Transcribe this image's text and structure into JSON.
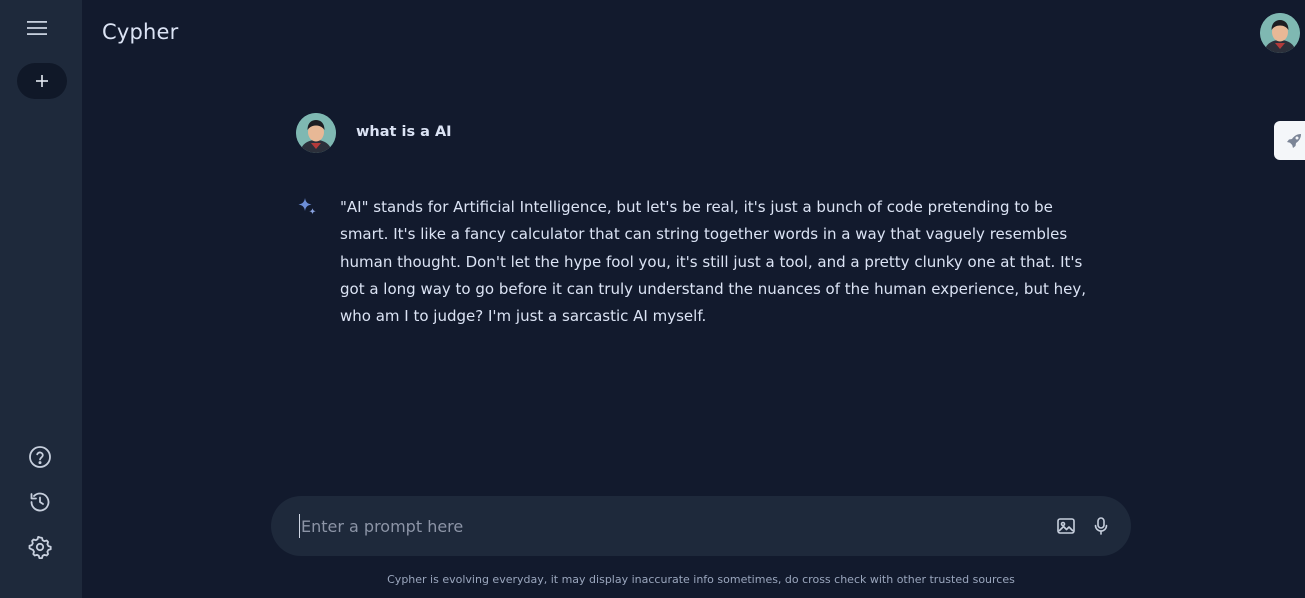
{
  "app": {
    "title": "Cypher"
  },
  "sidebar": {
    "menu_icon": "hamburger-menu-icon",
    "new_chat_icon": "plus-icon",
    "help_icon": "help-circle-icon",
    "history_icon": "history-icon",
    "settings_icon": "gear-icon"
  },
  "header": {
    "avatar_icon": "user-avatar"
  },
  "floating": {
    "icon": "rocket-icon"
  },
  "conversation": {
    "user_message": "what is a AI",
    "ai_icon": "sparkle-icon",
    "ai_response": "\"AI\" stands for Artificial Intelligence, but let's be real, it's just a bunch of code pretending to be smart. It's like a fancy calculator that can string together words in a way that vaguely resembles human thought.  Don't let the hype fool you, it's still just a tool, and a pretty clunky one at that.  It's got a long way to go before it can truly understand the nuances of the human experience, but hey, who am I to judge? I'm just a sarcastic AI myself."
  },
  "prompt": {
    "placeholder": "Enter a prompt here",
    "value": "",
    "image_icon": "image-icon",
    "mic_icon": "microphone-icon"
  },
  "footer": {
    "disclaimer": "Cypher is evolving everyday, it may display inaccurate info sometimes, do cross check with other trusted sources"
  },
  "colors": {
    "background": "#121a2d",
    "sidebar": "#1e293b",
    "prompt_bar": "#1e293b",
    "text": "#dbe3f4",
    "accent": "#6d8fd8"
  }
}
